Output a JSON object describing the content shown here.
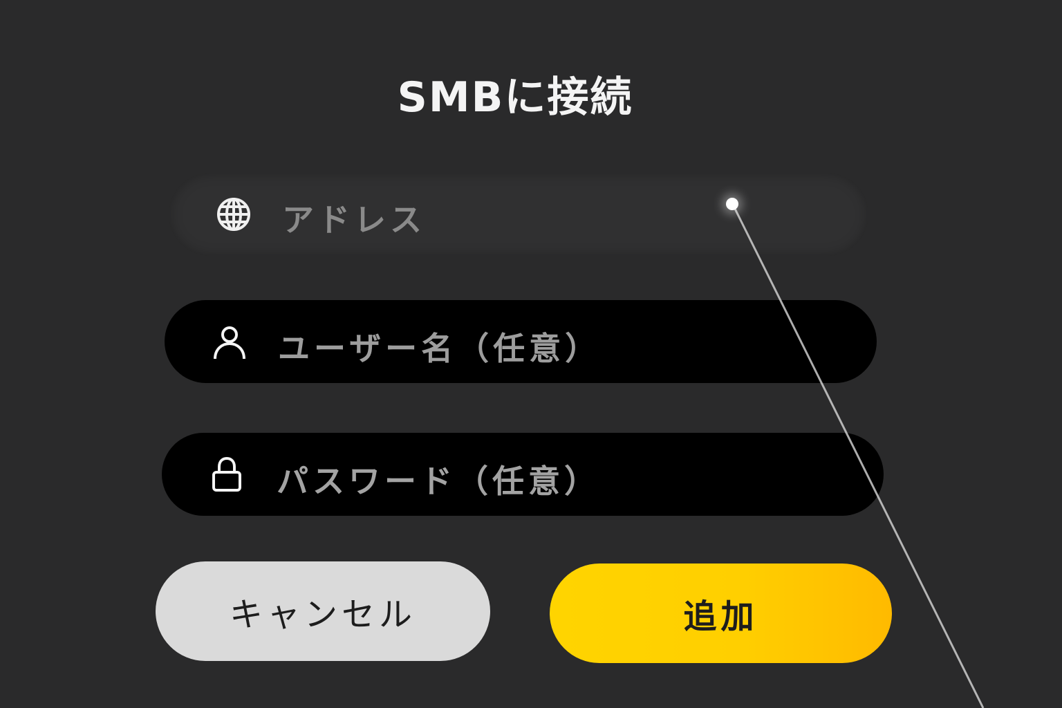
{
  "dialog": {
    "title": "SMBに接続"
  },
  "fields": {
    "address": {
      "icon": "globe-icon",
      "placeholder": "アドレス",
      "value": ""
    },
    "username": {
      "icon": "user-icon",
      "placeholder": "ユーザー名（任意）",
      "value": ""
    },
    "password": {
      "icon": "lock-icon",
      "placeholder": "パスワード（任意）",
      "value": ""
    }
  },
  "buttons": {
    "cancel_label": "キャンセル",
    "add_label": "追加"
  },
  "colors": {
    "background": "#2a2a2b",
    "field_active": "#000000",
    "field_hover": "#303031",
    "cancel_button": "#dadada",
    "add_button_accent": "#ffcf00"
  }
}
